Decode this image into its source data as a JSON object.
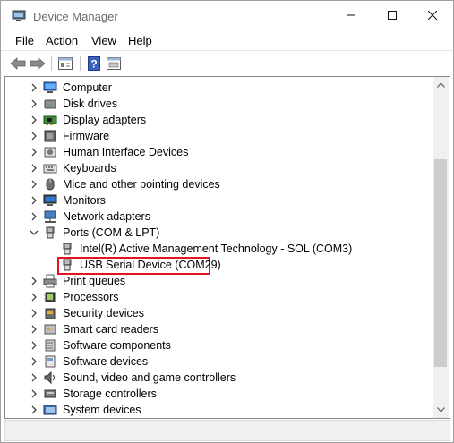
{
  "window": {
    "title": "Device Manager"
  },
  "menu": {
    "file": "File",
    "action": "Action",
    "view": "View",
    "help": "Help"
  },
  "toolbar": [
    "back-icon",
    "forward-icon",
    "properties-icon",
    "help-icon",
    "update-driver-icon"
  ],
  "tree": {
    "items": [
      {
        "label": "Computer",
        "icon": "computer-icon",
        "expanded": false
      },
      {
        "label": "Disk drives",
        "icon": "disk-drive-icon",
        "expanded": false
      },
      {
        "label": "Display adapters",
        "icon": "display-adapter-icon",
        "expanded": false
      },
      {
        "label": "Firmware",
        "icon": "firmware-icon",
        "expanded": false
      },
      {
        "label": "Human Interface Devices",
        "icon": "hid-icon",
        "expanded": false
      },
      {
        "label": "Keyboards",
        "icon": "keyboard-icon",
        "expanded": false
      },
      {
        "label": "Mice and other pointing devices",
        "icon": "mouse-icon",
        "expanded": false
      },
      {
        "label": "Monitors",
        "icon": "monitor-icon",
        "expanded": false
      },
      {
        "label": "Network adapters",
        "icon": "network-adapter-icon",
        "expanded": false
      },
      {
        "label": "Ports (COM & LPT)",
        "icon": "port-icon",
        "expanded": true
      },
      {
        "label": "Intel(R) Active Management Technology - SOL (COM3)",
        "icon": "port-icon",
        "child": true
      },
      {
        "label": "USB Serial Device (COM29)",
        "icon": "port-icon",
        "child": true,
        "highlighted": true
      },
      {
        "label": "Print queues",
        "icon": "printer-icon",
        "expanded": false
      },
      {
        "label": "Processors",
        "icon": "processor-icon",
        "expanded": false
      },
      {
        "label": "Security devices",
        "icon": "security-device-icon",
        "expanded": false
      },
      {
        "label": "Smart card readers",
        "icon": "smart-card-icon",
        "expanded": false
      },
      {
        "label": "Software components",
        "icon": "software-component-icon",
        "expanded": false
      },
      {
        "label": "Software devices",
        "icon": "software-device-icon",
        "expanded": false
      },
      {
        "label": "Sound, video and game controllers",
        "icon": "sound-icon",
        "expanded": false
      },
      {
        "label": "Storage controllers",
        "icon": "storage-controller-icon",
        "expanded": false
      },
      {
        "label": "System devices",
        "icon": "system-device-icon",
        "expanded": false
      }
    ]
  },
  "colors": {
    "highlight_border": "#e81123",
    "accent": "#1e6fd9"
  }
}
